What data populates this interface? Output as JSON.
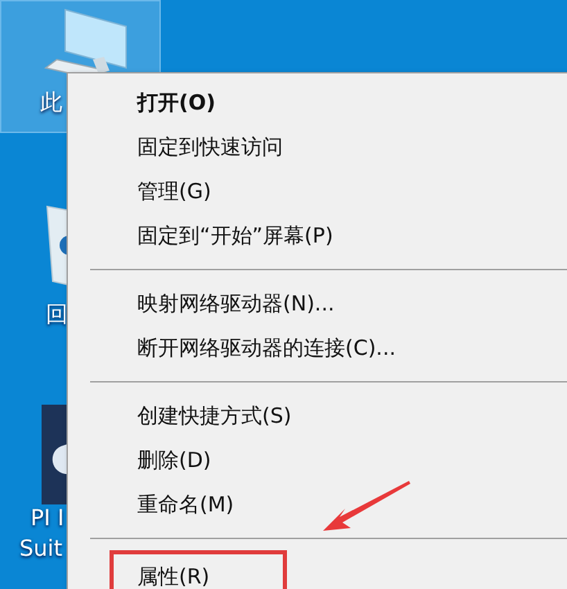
{
  "desktop_icons": [
    {
      "kind": "computer",
      "lines": [
        "此"
      ],
      "selected": true
    },
    {
      "kind": "recycle",
      "lines": [
        "回"
      ],
      "selected": false
    },
    {
      "kind": "app",
      "lines": [
        "PI I",
        "Suit"
      ],
      "selected": false
    }
  ],
  "context_menu": {
    "items": [
      {
        "kind": "item",
        "label": "打开(O)",
        "default": true,
        "highlighted": false
      },
      {
        "kind": "item",
        "label": "固定到快速访问",
        "default": false,
        "highlighted": false
      },
      {
        "kind": "item",
        "label": "管理(G)",
        "default": false,
        "highlighted": false
      },
      {
        "kind": "item",
        "label": "固定到“开始”屏幕(P)",
        "default": false,
        "highlighted": false
      },
      {
        "kind": "separator"
      },
      {
        "kind": "item",
        "label": "映射网络驱动器(N)...",
        "default": false,
        "highlighted": false
      },
      {
        "kind": "item",
        "label": "断开网络驱动器的连接(C)...",
        "default": false,
        "highlighted": false
      },
      {
        "kind": "separator"
      },
      {
        "kind": "item",
        "label": "创建快捷方式(S)",
        "default": false,
        "highlighted": false
      },
      {
        "kind": "item",
        "label": "删除(D)",
        "default": false,
        "highlighted": false
      },
      {
        "kind": "item",
        "label": "重命名(M)",
        "default": false,
        "highlighted": false
      },
      {
        "kind": "separator"
      },
      {
        "kind": "item",
        "label": "属性(R)",
        "default": false,
        "highlighted": true
      }
    ]
  }
}
